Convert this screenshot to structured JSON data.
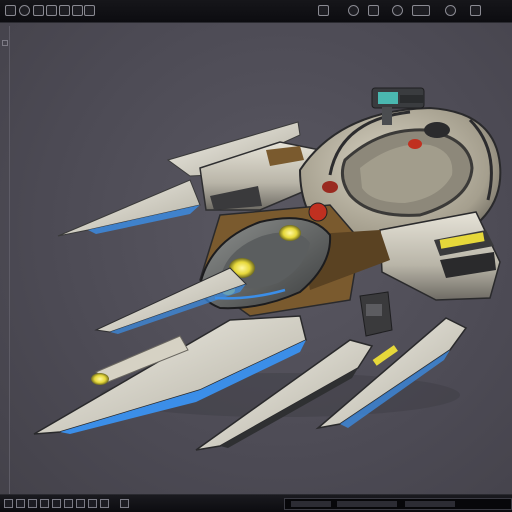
{
  "colors": {
    "background": "#4c4a54",
    "toolbar": "#0e0e12",
    "hull_light": "#d9d6cc",
    "hull_mid": "#a8a497",
    "hull_dark": "#3a3a3c",
    "accent_bronze": "#7a5a2e",
    "accent_blue": "#3b8ee8",
    "accent_yellow": "#e6d83a",
    "accent_red": "#c03020",
    "accent_teal": "#4ab8b0"
  },
  "top_toolbar": {
    "icons": [
      "tool-icon",
      "tool-icon",
      "tool-icon",
      "tool-icon",
      "tool-icon",
      "tool-icon",
      "tool-icon",
      "tool-icon",
      "tool-icon",
      "tool-icon",
      "tool-icon",
      "tool-icon",
      "tool-icon",
      "tool-icon"
    ]
  },
  "viewport": {
    "subject": "spaceship-model"
  },
  "bottom_toolbar": {
    "icons": [
      "tool-icon",
      "tool-icon",
      "tool-icon",
      "tool-icon",
      "tool-icon",
      "tool-icon",
      "tool-icon",
      "tool-icon",
      "tool-icon",
      "tool-icon"
    ]
  }
}
